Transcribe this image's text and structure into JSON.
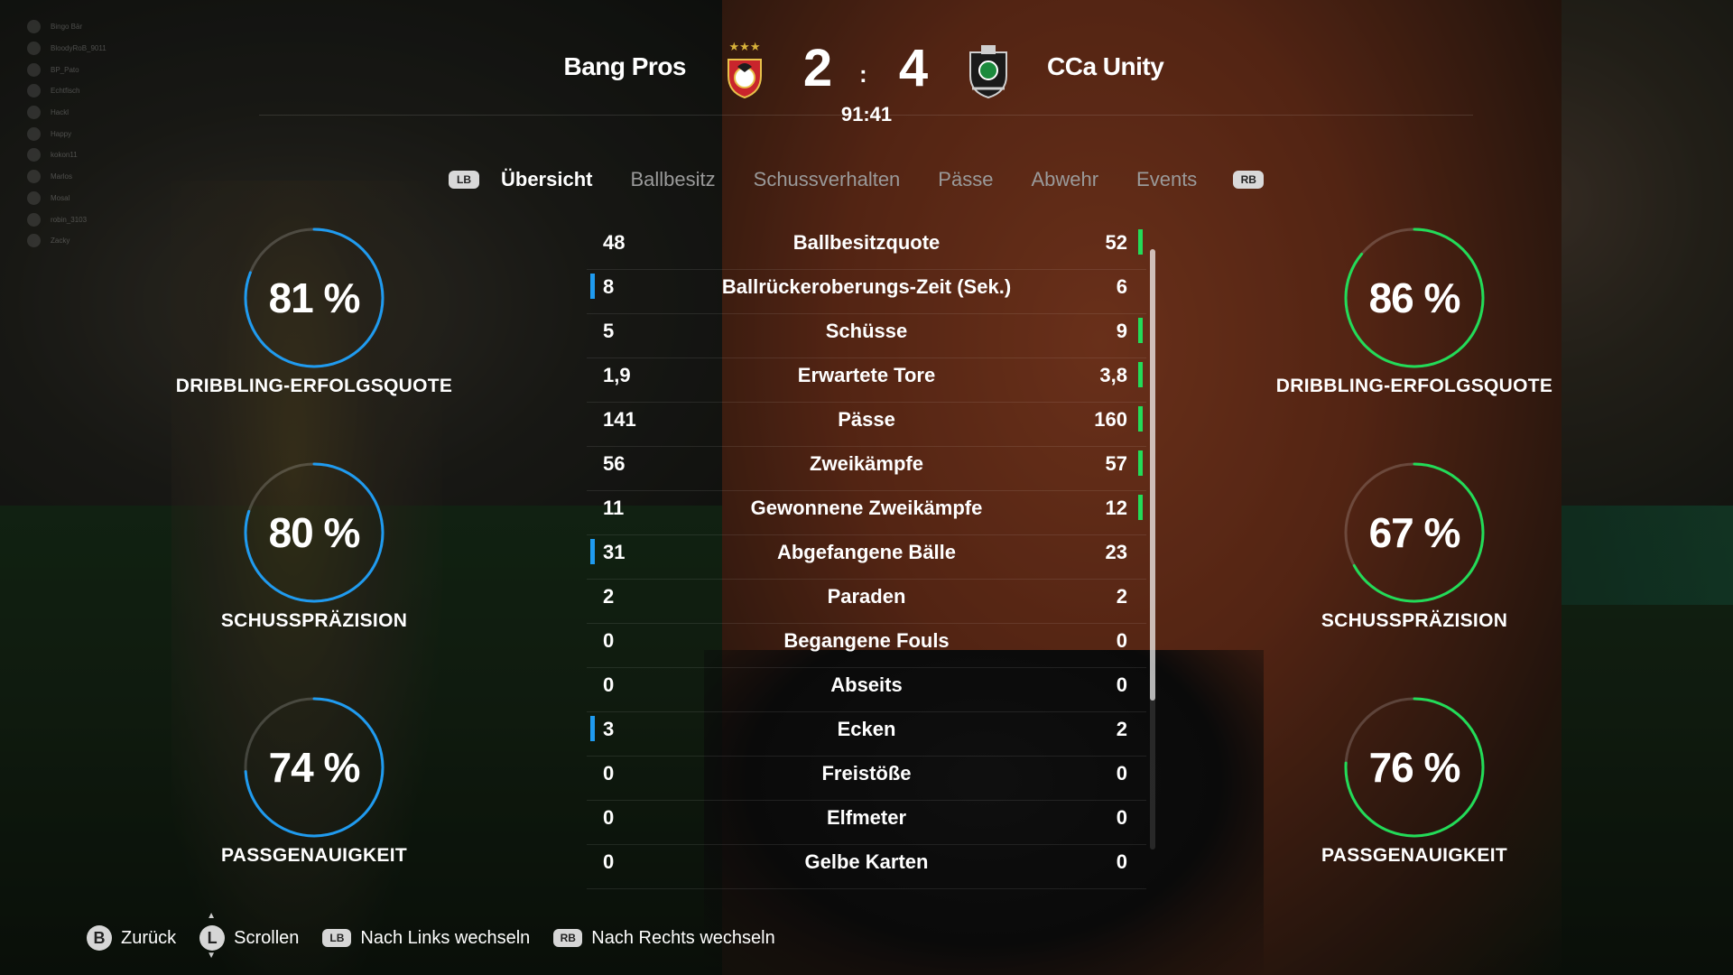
{
  "friends": [
    "Bingo Bär",
    "BloodyRoB_9011",
    "BP_Pato",
    "Echtfisch",
    "Hackl",
    "Happy",
    "kokon11",
    "Marlos",
    "Mosal",
    "robin_3103",
    "Zacky"
  ],
  "match": {
    "home_team": "Bang Pros",
    "away_team": "CCa Unity",
    "home_score": "2",
    "away_score": "4",
    "separator": ":",
    "clock": "91:41"
  },
  "tabs": {
    "lb": "LB",
    "rb": "RB",
    "items": [
      "Übersicht",
      "Ballbesitz",
      "Schussverhalten",
      "Pässe",
      "Abwehr",
      "Events"
    ]
  },
  "stats": [
    {
      "name": "Ballbesitzquote",
      "home": "48",
      "away": "52",
      "leader": "away"
    },
    {
      "name": "Ballrückeroberungs-Zeit (Sek.)",
      "home": "8",
      "away": "6",
      "leader": "home"
    },
    {
      "name": "Schüsse",
      "home": "5",
      "away": "9",
      "leader": "away"
    },
    {
      "name": "Erwartete Tore",
      "home": "1,9",
      "away": "3,8",
      "leader": "away"
    },
    {
      "name": "Pässe",
      "home": "141",
      "away": "160",
      "leader": "away"
    },
    {
      "name": "Zweikämpfe",
      "home": "56",
      "away": "57",
      "leader": "away"
    },
    {
      "name": "Gewonnene Zweikämpfe",
      "home": "11",
      "away": "12",
      "leader": "away"
    },
    {
      "name": "Abgefangene Bälle",
      "home": "31",
      "away": "23",
      "leader": "home"
    },
    {
      "name": "Paraden",
      "home": "2",
      "away": "2",
      "leader": "none"
    },
    {
      "name": "Begangene Fouls",
      "home": "0",
      "away": "0",
      "leader": "none"
    },
    {
      "name": "Abseits",
      "home": "0",
      "away": "0",
      "leader": "none"
    },
    {
      "name": "Ecken",
      "home": "3",
      "away": "2",
      "leader": "home"
    },
    {
      "name": "Freistöße",
      "home": "0",
      "away": "0",
      "leader": "none"
    },
    {
      "name": "Elfmeter",
      "home": "0",
      "away": "0",
      "leader": "none"
    },
    {
      "name": "Gelbe Karten",
      "home": "0",
      "away": "0",
      "leader": "none"
    }
  ],
  "rings": {
    "home": [
      {
        "value": 81,
        "text": "81 %",
        "label": "DRIBBLING-ERFOLGSQUOTE"
      },
      {
        "value": 80,
        "text": "80 %",
        "label": "SCHUSSPRÄZISION"
      },
      {
        "value": 74,
        "text": "74 %",
        "label": "PASSGENAUIGKEIT"
      }
    ],
    "away": [
      {
        "value": 86,
        "text": "86 %",
        "label": "DRIBBLING-ERFOLGSQUOTE"
      },
      {
        "value": 67,
        "text": "67 %",
        "label": "SCHUSSPRÄZISION"
      },
      {
        "value": 76,
        "text": "76 %",
        "label": "PASSGENAUIGKEIT"
      }
    ]
  },
  "footer": {
    "back_key": "B",
    "back": "Zurück",
    "scroll_key": "L",
    "scroll": "Scrollen",
    "left_key": "LB",
    "left": "Nach Links wechseln",
    "right_key": "RB",
    "right": "Nach Rechts wechseln"
  },
  "colors": {
    "home": "#1f9bf0",
    "away": "#22dc58"
  }
}
